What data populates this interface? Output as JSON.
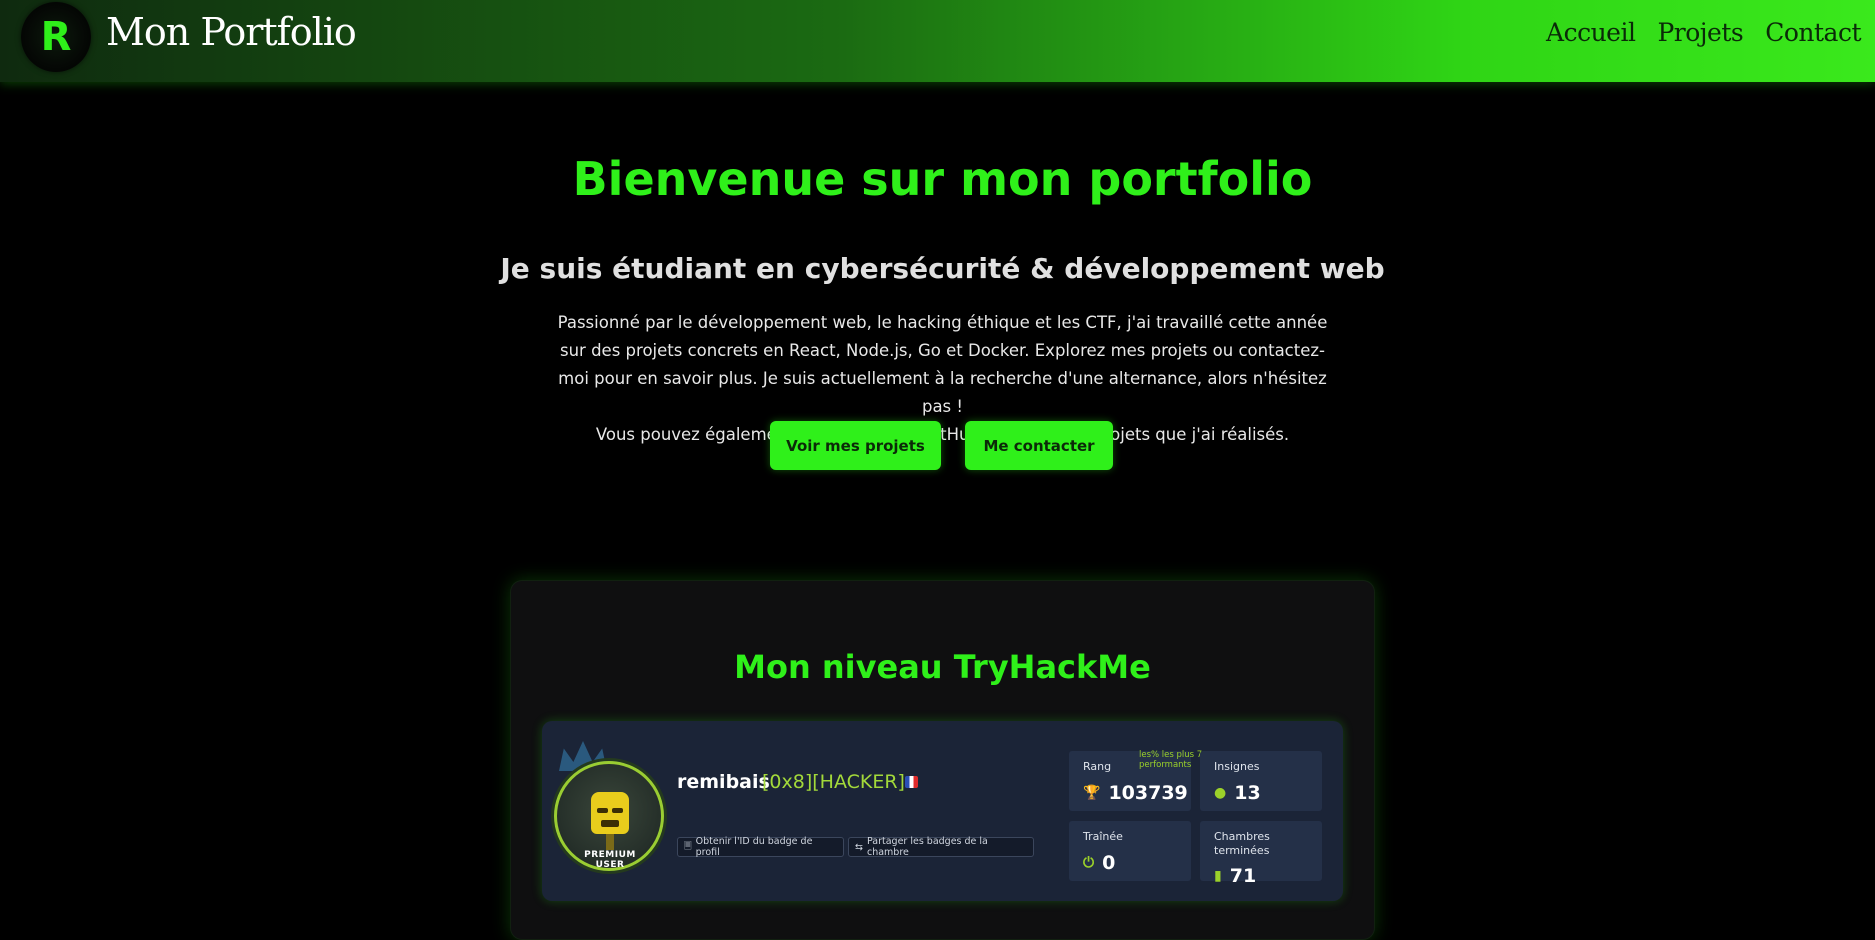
{
  "header": {
    "logo_letter": "R",
    "brand": "Mon Portfolio",
    "nav": [
      "Accueil",
      "Projets",
      "Contact"
    ]
  },
  "hero": {
    "title": "Bienvenue sur mon portfolio",
    "subtitle": "Je suis étudiant en cybersécurité & développement web",
    "paragraph1": "Passionné par le développement web, le hacking éthique et les CTF, j'ai travaillé cette année sur des projets concrets en React, Node.js, Go et Docker. Explorez mes projets ou contactez-moi pour en savoir plus. Je suis actuellement à la recherche d'une alternance, alors n'hésitez pas !",
    "paragraph2": "Vous pouvez également consulter mon GitHub pour voir les projets que j'ai réalisés.",
    "btn_projects": "Voir mes projets",
    "btn_contact": "Me contacter"
  },
  "tryhackme": {
    "title": "Mon niveau TryHackMe",
    "premium_label": "PREMIUM USER",
    "username": "remibais",
    "rank_tag": "[0x8][HACKER]",
    "chip_profile_id": "Obtenir l'ID du badge de profil",
    "chip_share": "Partager les badges de la chambre",
    "stats": {
      "rang_label": "Rang",
      "rang_note": "les% les plus 7 performants",
      "rang_value": "103739",
      "insignes_label": "Insignes",
      "insignes_value": "13",
      "trainee_label": "Traînée",
      "trainee_value": "0",
      "chambres_label": "Chambres terminées",
      "chambres_value": "71"
    }
  },
  "colors": {
    "accent": "#2ff01a",
    "card_bg": "#1b2437",
    "rank_green": "#a3d93a"
  }
}
